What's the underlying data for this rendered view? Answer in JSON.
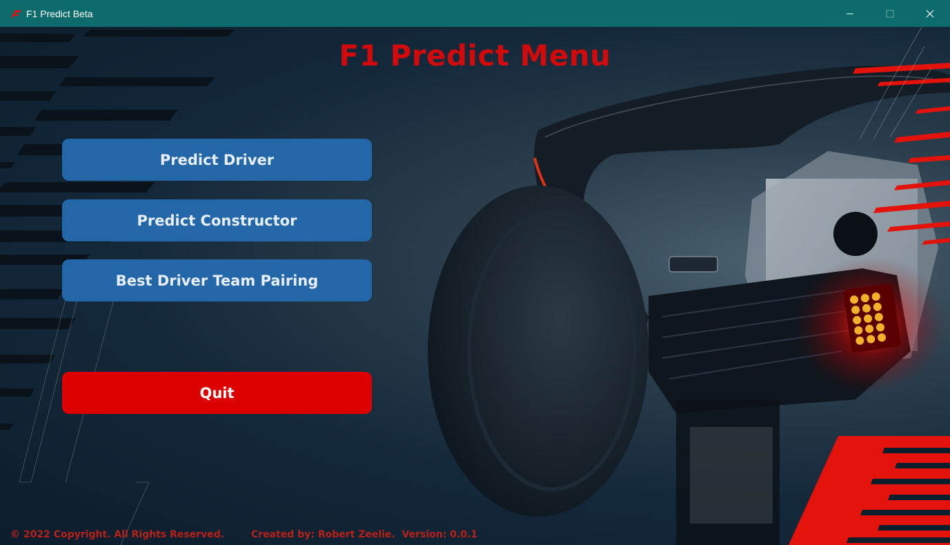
{
  "window": {
    "title": "F1 Predict Beta",
    "icon": "f1-logo-icon",
    "controls": [
      "minimize-icon",
      "maximize-icon",
      "close-icon"
    ]
  },
  "menu": {
    "title": "F1 Predict Menu",
    "buttons": {
      "predict_driver": "Predict Driver",
      "predict_constructor": "Predict Constructor",
      "best_pairing": "Best Driver Team Pairing",
      "quit": "Quit"
    }
  },
  "footer": {
    "copyright": "© 2022 Copyright. All Rights Reserved.",
    "credits": "Created by: Robert Zeelie.  Version: 0.0.1"
  },
  "colors": {
    "titlebar": "#0d6b6b",
    "title_text": "#d10b0b",
    "primary_button": "#2367a8",
    "quit_button": "#dd0000",
    "footer_text": "#b8201a"
  }
}
